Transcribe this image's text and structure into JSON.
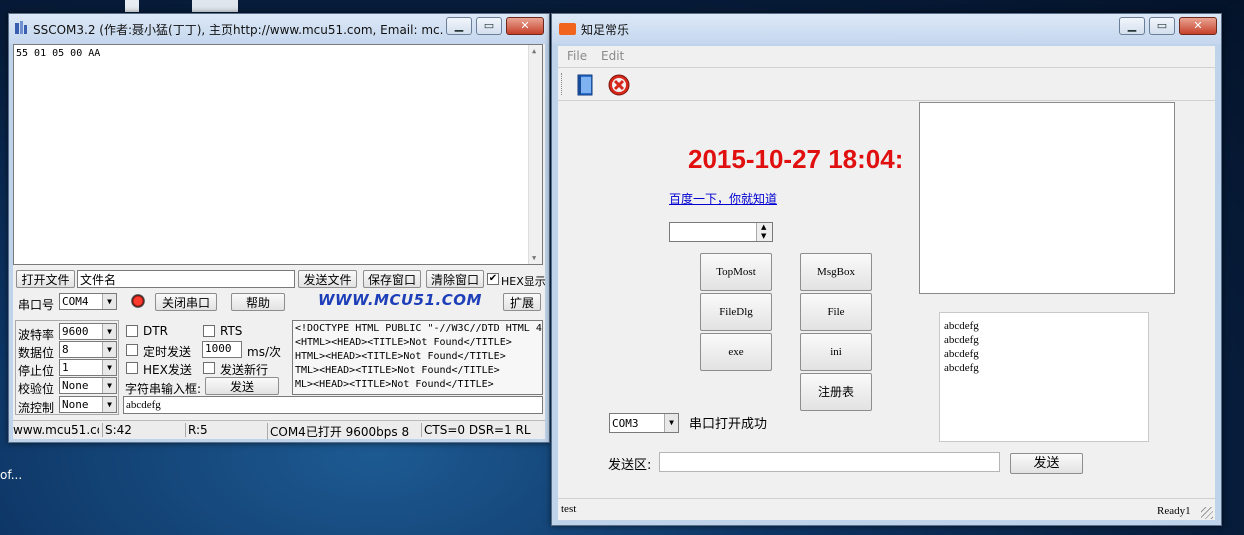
{
  "desktop": {
    "frag_text": "of..."
  },
  "sscom": {
    "title": "SSCOM3.2 (作者:聂小猛(丁丁), 主页http://www.mcu51.com,  Email: mc...",
    "receive_text": "55 01 05 00 AA",
    "row1": {
      "open_file": "打开文件",
      "file_name": "文件名",
      "send_file": "发送文件",
      "save_window": "保存窗口",
      "clear_window": "清除窗口",
      "hex_display": "HEX显示",
      "hex_display_checked": "✔"
    },
    "row2": {
      "port_label": "串口号",
      "port_value": "COM4",
      "close_port": "关闭串口",
      "help": "帮助",
      "brand": "WWW.MCU51.COM",
      "expand": "扩展"
    },
    "settings": {
      "baud_label": "波特率",
      "baud_value": "9600",
      "databits_label": "数据位",
      "databits_value": "8",
      "stopbits_label": "停止位",
      "stopbits_value": "1",
      "parity_label": "校验位",
      "parity_value": "None",
      "flow_label": "流控制",
      "flow_value": "None"
    },
    "options": {
      "dtr": "DTR",
      "rts": "RTS",
      "timed_send": "定时发送",
      "interval_value": "1000",
      "interval_unit": "ms/次",
      "hex_send": "HEX发送",
      "send_newline": "发送新行",
      "string_input_label": "字符串输入框:",
      "send_button": "发送",
      "send_value": "abcdefg"
    },
    "log_lines": [
      "<!DOCTYPE HTML PUBLIC \"-//W3C//DTD HTML 4.",
      "<HTML><HEAD><TITLE>Not Found</TITLE>",
      "HTML><HEAD><TITLE>Not Found</TITLE>",
      "TML><HEAD><TITLE>Not Found</TITLE>",
      "ML><HEAD><TITLE>Not Found</TITLE>"
    ],
    "status": {
      "url": "www.mcu51.cor",
      "sent": "S:42",
      "recv": "R:5",
      "port_state": "COM4已打开  9600bps  8",
      "line_state": "CTS=0 DSR=1 RL"
    }
  },
  "app": {
    "title": "知足常乐",
    "menu": [
      "File",
      "Edit"
    ],
    "toolbar": {
      "book_icon": "book-icon",
      "close_icon": "close-circle-icon"
    },
    "datetime": "2015-10-27 18:04:",
    "link_text": "百度一下，你就知道",
    "buttons": {
      "topmost": "TopMost",
      "msgbox": "MsgBox",
      "filedlg": "FileDlg",
      "file": "File",
      "exe": "exe",
      "ini": "ini",
      "registry": "注册表"
    },
    "port_value": "COM3",
    "port_status": "串口打开成功",
    "send_area_label": "发送区:",
    "send_button": "发送",
    "list_items": [
      "abcdefg",
      "abcdefg",
      "abcdefg",
      "abcdefg"
    ],
    "status_left": "test",
    "status_right": "Ready1",
    "accent_red": "#e01010"
  }
}
